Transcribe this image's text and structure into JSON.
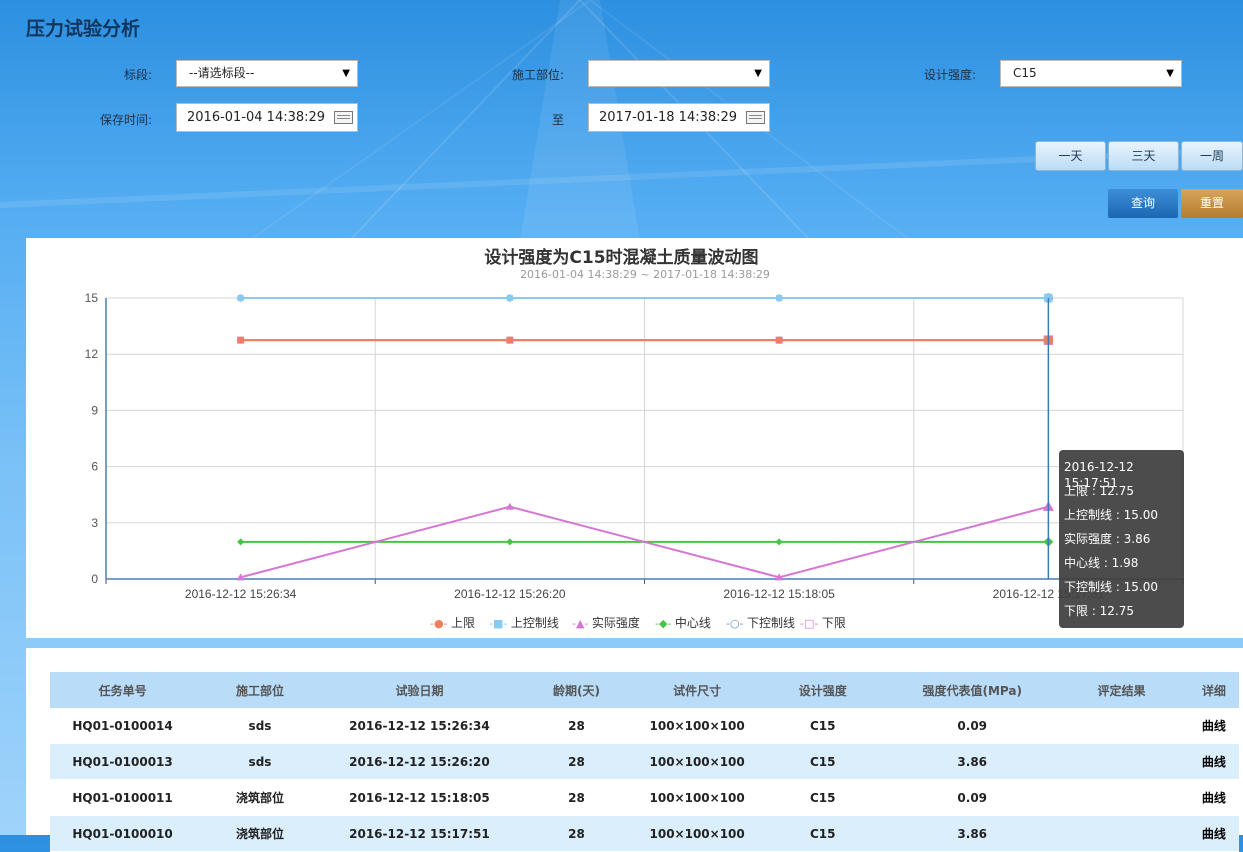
{
  "page": {
    "title": "压力试验分析"
  },
  "filters": {
    "section_label": "标段:",
    "section_value": "--请选标段--",
    "part_label": "施工部位:",
    "part_value": "",
    "strength_label": "设计强度:",
    "strength_value": "C15",
    "save_time_label": "保存时间:",
    "start_time": "2016-01-04 14:38:29",
    "to_label": "至",
    "end_time": "2017-01-18 14:38:29"
  },
  "range_buttons": {
    "one_day": "一天",
    "three_days": "三天",
    "one_week": "一周"
  },
  "actions": {
    "query": "查询",
    "reset": "重置"
  },
  "chart_data": {
    "type": "line",
    "title": "设计强度为C15时混凝土质量波动图",
    "subtitle": "2016-01-04 14:38:29 ~ 2017-01-18 14:38:29",
    "categories": [
      "2016-12-12 15:26:34",
      "2016-12-12 15:26:20",
      "2016-12-12 15:18:05",
      "2016-12-12 15:17:51"
    ],
    "ylim": [
      0,
      15
    ],
    "yticks": [
      0,
      3,
      6,
      9,
      12,
      15
    ],
    "grid": true,
    "legend_position": "bottom",
    "series": [
      {
        "name": "上限",
        "values": [
          12.75,
          12.75,
          12.75,
          12.75
        ],
        "color": "#ee7f5b",
        "marker": "circle"
      },
      {
        "name": "上控制线",
        "values": [
          15.0,
          15.0,
          15.0,
          15.0
        ],
        "color": "#87cbf0",
        "marker": "square"
      },
      {
        "name": "实际强度",
        "values": [
          0.09,
          3.86,
          0.09,
          3.86
        ],
        "color": "#d676d4",
        "marker": "triangle"
      },
      {
        "name": "中心线",
        "values": [
          1.98,
          1.98,
          1.98,
          1.98
        ],
        "color": "#46c443",
        "marker": "diamond"
      },
      {
        "name": "下控制线",
        "values": [
          15.0,
          15.0,
          15.0,
          15.0
        ],
        "color": "#6b94c8",
        "marker": "circle-hollow"
      },
      {
        "name": "下限",
        "values": [
          12.75,
          12.75,
          12.75,
          12.75
        ],
        "color": "#d676d4",
        "marker": "square-hollow"
      }
    ],
    "tooltip": {
      "header": "2016-12-12 15:17:51",
      "lines": [
        "上限 : 12.75",
        "上控制线 : 15.00",
        "实际强度 : 3.86",
        "中心线 : 1.98",
        "下控制线 : 15.00",
        "下限 : 12.75"
      ]
    }
  },
  "table": {
    "headers": [
      "任务单号",
      "施工部位",
      "试验日期",
      "龄期(天)",
      "试件尺寸",
      "设计强度",
      "强度代表值(MPa)",
      "评定结果",
      "详细"
    ],
    "rows": [
      [
        "HQ01-0100014",
        "sds",
        "2016-12-12 15:26:34",
        "28",
        "100×100×100",
        "C15",
        "0.09",
        "",
        "曲线"
      ],
      [
        "HQ01-0100013",
        "sds",
        "2016-12-12 15:26:20",
        "28",
        "100×100×100",
        "C15",
        "3.86",
        "",
        "曲线"
      ],
      [
        "HQ01-0100011",
        "浇筑部位",
        "2016-12-12 15:18:05",
        "28",
        "100×100×100",
        "C15",
        "0.09",
        "",
        "曲线"
      ],
      [
        "HQ01-0100010",
        "浇筑部位",
        "2016-12-12 15:17:51",
        "28",
        "100×100×100",
        "C15",
        "3.86",
        "",
        "曲线"
      ]
    ]
  }
}
